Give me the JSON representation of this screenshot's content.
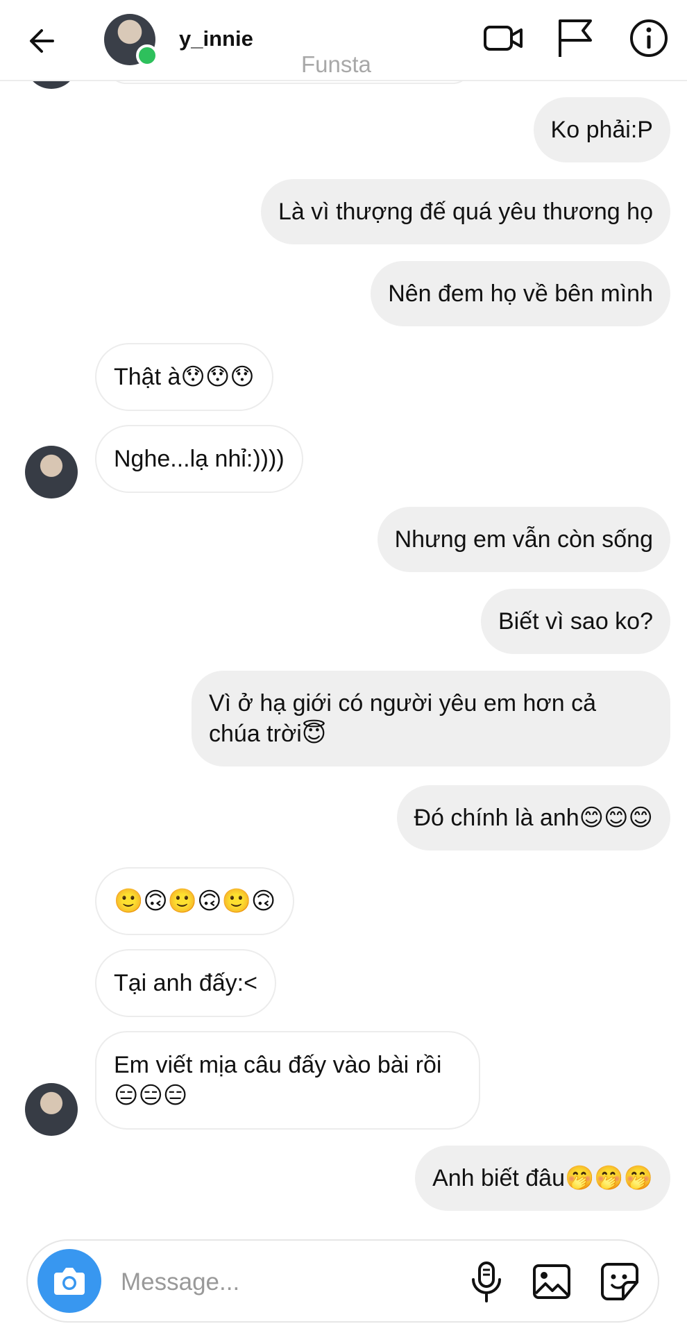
{
  "header": {
    "username": "y_innie",
    "subtitle": "Funsta",
    "icons": [
      "back-arrow-icon",
      "video-call-icon",
      "flag-icon",
      "info-icon"
    ]
  },
  "messages": [
    {
      "dir": "out",
      "text": "Ko phải:P"
    },
    {
      "dir": "out",
      "text": "Là vì thượng đế quá yêu thương họ"
    },
    {
      "dir": "out",
      "text": "Nên đem họ về bên mình"
    },
    {
      "dir": "in",
      "text": "Thật à😯😯😯"
    },
    {
      "dir": "in",
      "text": "Nghe...lạ nhỉ:))))"
    },
    {
      "dir": "out",
      "text": "Nhưng em vẫn còn sống"
    },
    {
      "dir": "out",
      "text": "Biết vì sao ko?"
    },
    {
      "dir": "out",
      "text": "Vì ở hạ giới có người yêu em hơn cả chúa trời😇"
    },
    {
      "dir": "out",
      "text": "Đó chính là anh😊😊😊"
    },
    {
      "dir": "in",
      "text": "🙂🙃🙂🙃🙂🙃"
    },
    {
      "dir": "in",
      "text": "Tại anh đấy:<"
    },
    {
      "dir": "in",
      "text": "Em viết mịa câu đấy vào bài rồi😑😑😑"
    },
    {
      "dir": "out",
      "text": "Anh biết đâu🤭🤭🤭"
    }
  ],
  "composer": {
    "placeholder": "Message...",
    "icons": [
      "camera-icon",
      "microphone-icon",
      "gallery-icon",
      "sticker-icon"
    ]
  },
  "colors": {
    "accent": "#3897f0",
    "outgoing_bubble": "#efefef",
    "incoming_border": "#ececec",
    "online": "#2ec05c"
  }
}
